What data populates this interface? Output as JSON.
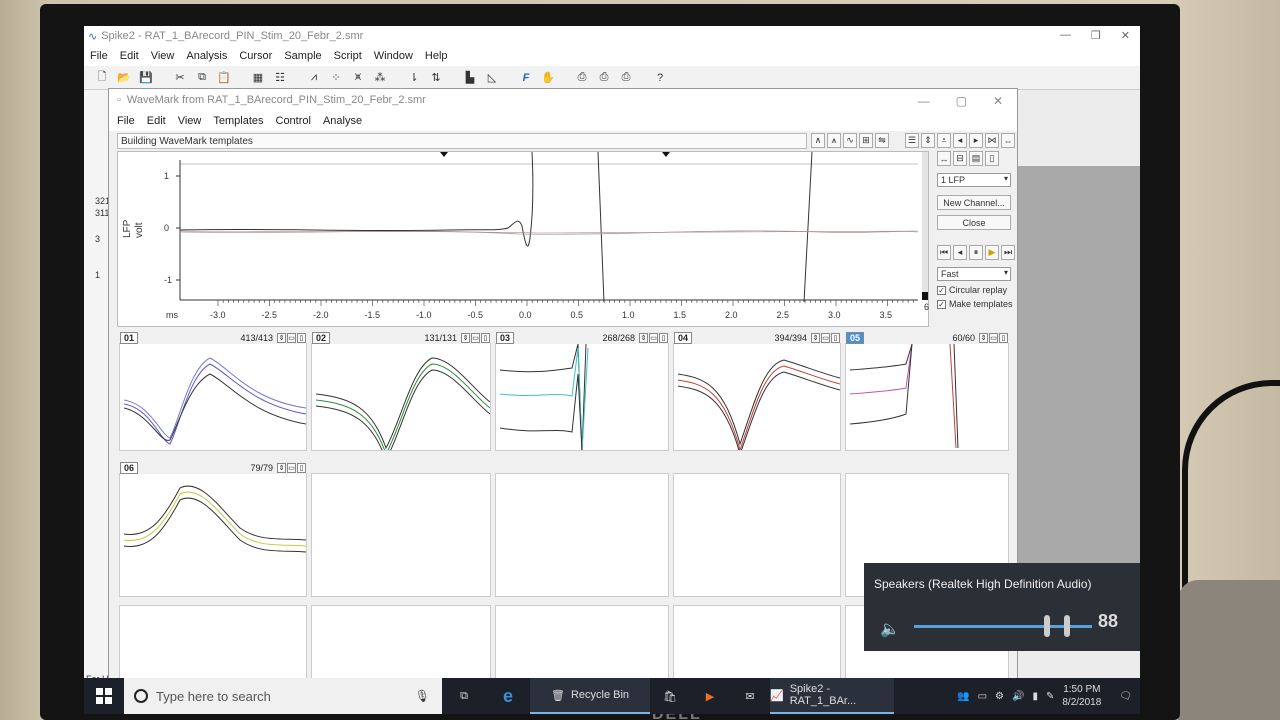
{
  "main_window": {
    "title": "Spike2 - RAT_1_BArecord_PIN_Stim_20_Febr_2.smr",
    "menu": [
      "File",
      "Edit",
      "View",
      "Analysis",
      "Cursor",
      "Sample",
      "Script",
      "Window",
      "Help"
    ],
    "left_values": [
      "321",
      "311",
      "3",
      "1"
    ],
    "bottom_left_text": "For H"
  },
  "wavemark": {
    "title": "WaveMark from RAT_1_BArecord_PIN_Stim_20_Febr_2.smr",
    "menu": [
      "File",
      "Edit",
      "View",
      "Templates",
      "Control",
      "Analyse"
    ],
    "status": "Building WaveMark templates",
    "plot": {
      "y_label_1": "LFP",
      "y_label_2": "volt",
      "x_unit": "ms",
      "y_ticks": [
        "1",
        "0",
        "-1"
      ],
      "x_ticks": [
        "-3.0",
        "-2.5",
        "-2.0",
        "-1.5",
        "-1.0",
        "-0.5",
        "0.0",
        "0.5",
        "1.0",
        "1.5",
        "2.0",
        "2.5",
        "3.0",
        "3.5"
      ],
      "x_right_label": "6"
    },
    "controls": {
      "channel_select": "1 LFP",
      "new_channel": "New Channel...",
      "close": "Close",
      "speed_select": "Fast",
      "circular_replay": "Circular replay",
      "make_templates": "Make templates"
    },
    "templates": [
      {
        "id": "01",
        "count": "413/413"
      },
      {
        "id": "02",
        "count": "131/131"
      },
      {
        "id": "03",
        "count": "268/268"
      },
      {
        "id": "04",
        "count": "394/394"
      },
      {
        "id": "05",
        "count": "60/60"
      },
      {
        "id": "06",
        "count": "79/79"
      }
    ]
  },
  "taskbar": {
    "search_placeholder": "Type here to search",
    "recycle_bin": "Recycle Bin",
    "spike_task": "Spike2 - RAT_1_BAr...",
    "time": "1:50 PM",
    "date": "8/2/2018"
  },
  "volume": {
    "device": "Speakers (Realtek High Definition Audio)",
    "level": "88"
  },
  "colors": {
    "taskbar": "#1c2028",
    "accent": "#5aa0e0"
  }
}
